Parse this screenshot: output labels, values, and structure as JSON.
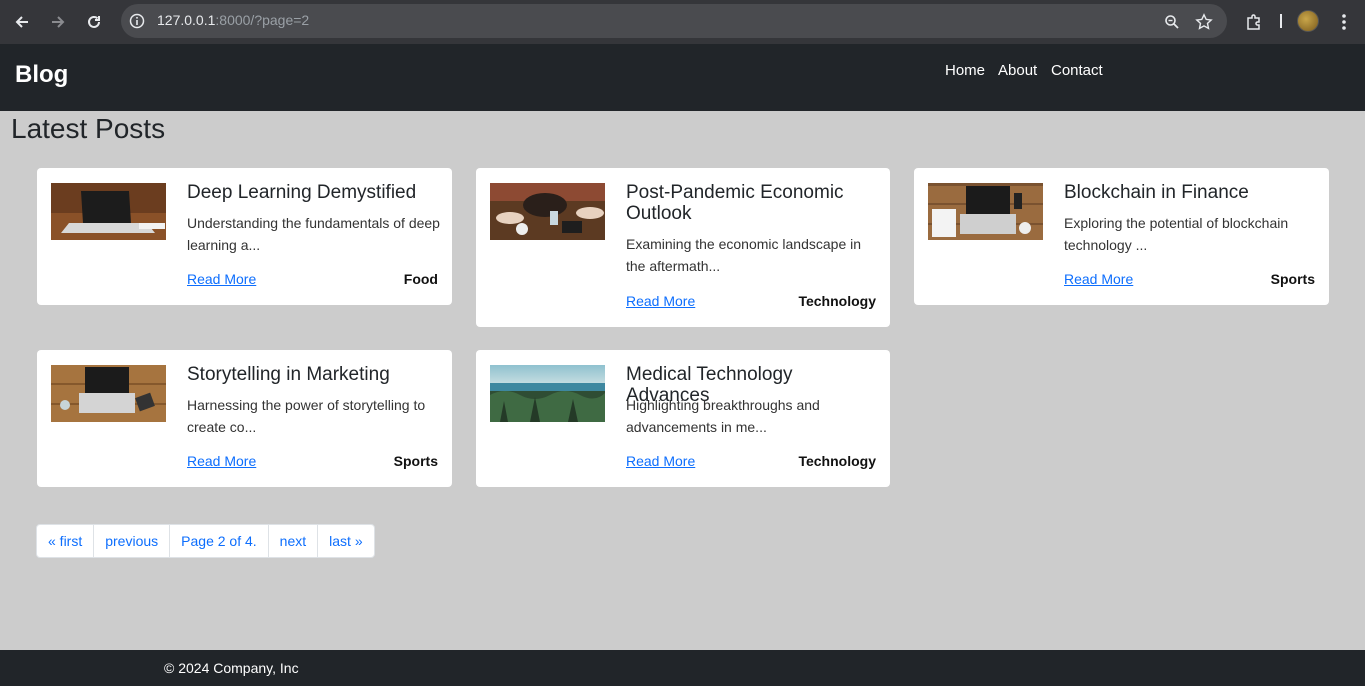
{
  "browser": {
    "url_host": "127.0.0.1",
    "url_rest": ":8000/?page=2"
  },
  "header": {
    "brand": "Blog",
    "nav": [
      "Home",
      "About",
      "Contact"
    ]
  },
  "page_title": "Latest Posts",
  "posts": [
    {
      "title": "Deep Learning Demystified",
      "excerpt": "Understanding the fundamentals of deep learning a...",
      "link": "Read More",
      "category": "Food"
    },
    {
      "title": "Post-Pandemic Economic Outlook",
      "excerpt": "Examining the economic landscape in the aftermath...",
      "link": "Read More",
      "category": "Technology"
    },
    {
      "title": "Blockchain in Finance",
      "excerpt": "Exploring the potential of blockchain technology ...",
      "link": "Read More",
      "category": "Sports"
    },
    {
      "title": "Storytelling in Marketing",
      "excerpt": "Harnessing the power of storytelling to create co...",
      "link": "Read More",
      "category": "Sports"
    },
    {
      "title": "Medical Technology Advances",
      "excerpt": "Highlighting breakthroughs and advancements in me...",
      "link": "Read More",
      "category": "Technology"
    }
  ],
  "pagination": {
    "first": "« first",
    "previous": "previous",
    "current": "Page 2 of 4.",
    "next": "next",
    "last": "last »"
  },
  "footer": "© 2024 Company, Inc",
  "colors": {
    "header_bg": "#212529",
    "page_bg": "#cccccc",
    "link": "#0d6efd"
  }
}
